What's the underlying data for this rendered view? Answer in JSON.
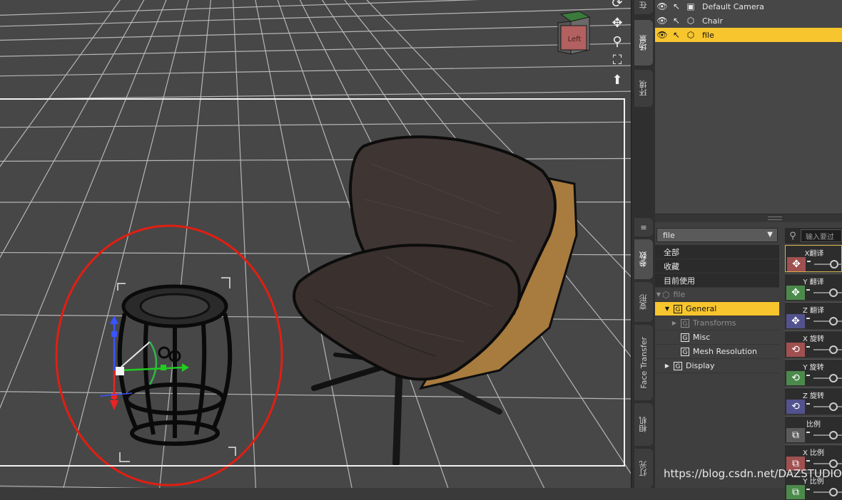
{
  "viewport": {
    "view_cube_label": "Left",
    "nav_icons": [
      "orbit-icon",
      "pan-icon",
      "zoom-icon",
      "frame-icon",
      "reset-icon"
    ]
  },
  "side_tabs": [
    "在",
    "场景",
    "环境",
    "参数",
    "变形",
    "Face Transfer",
    "相机",
    "灯光"
  ],
  "scene": {
    "items": [
      {
        "label": "Default Camera",
        "icon": "camera-icon",
        "selected": false
      },
      {
        "label": "Chair",
        "icon": "object-icon",
        "selected": false
      },
      {
        "label": "file",
        "icon": "object-icon",
        "selected": true
      }
    ]
  },
  "params": {
    "node_select": "file",
    "search_placeholder": "输入要过",
    "filters": [
      "全部",
      "收藏",
      "目前使用"
    ],
    "tree": {
      "root": "file",
      "groups": [
        {
          "label": "General",
          "selected": true
        },
        {
          "label": "Transforms"
        },
        {
          "label": "Misc"
        },
        {
          "label": "Mesh Resolution"
        },
        {
          "label": "Display"
        }
      ]
    },
    "properties": [
      {
        "label": "X翻译",
        "color": "#a05050",
        "icon": "✥"
      },
      {
        "label": "Y 翻译",
        "color": "#4c8a4c",
        "icon": "✥"
      },
      {
        "label": "Z 翻译",
        "color": "#52528e",
        "icon": "✥"
      },
      {
        "label": "X 旋转",
        "color": "#a05050",
        "icon": "⟲"
      },
      {
        "label": "Y 旋转",
        "color": "#4c8a4c",
        "icon": "⟲"
      },
      {
        "label": "Z 旋转",
        "color": "#52528e",
        "icon": "⟲"
      },
      {
        "label": "比例",
        "color": "#5a5a5a",
        "icon": "⧉"
      },
      {
        "label": "X 比例",
        "color": "#a05050",
        "icon": "⧉"
      },
      {
        "label": "Y 比例",
        "color": "#4c8a4c",
        "icon": "⧉"
      }
    ]
  },
  "watermark": "https://blog.csdn.net/DAZSTUDIO"
}
